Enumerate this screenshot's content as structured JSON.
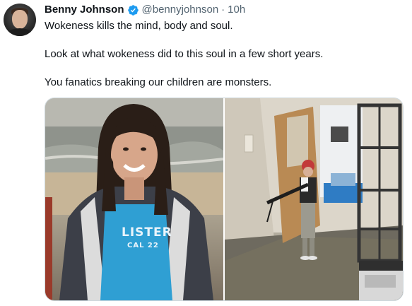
{
  "author": {
    "name": "Benny Johnson",
    "handle": "@bennyjohnson",
    "separator": "·",
    "time": "10h"
  },
  "tweet": {
    "line1": "Wokeness kills the mind, body and soul.",
    "line2": "Look at what wokeness did to this soul in a few short years.",
    "line3": "You fanatics breaking our children are monsters."
  },
  "media": {
    "left_photo": {
      "shirt_text": "LISTER",
      "shirt_subtext": "CAL 22"
    }
  },
  "colors": {
    "verified": "#1d9bf0",
    "secondary_text": "#536471",
    "primary_text": "#0f1419"
  },
  "icons": {
    "verified": "verified-badge-icon"
  }
}
